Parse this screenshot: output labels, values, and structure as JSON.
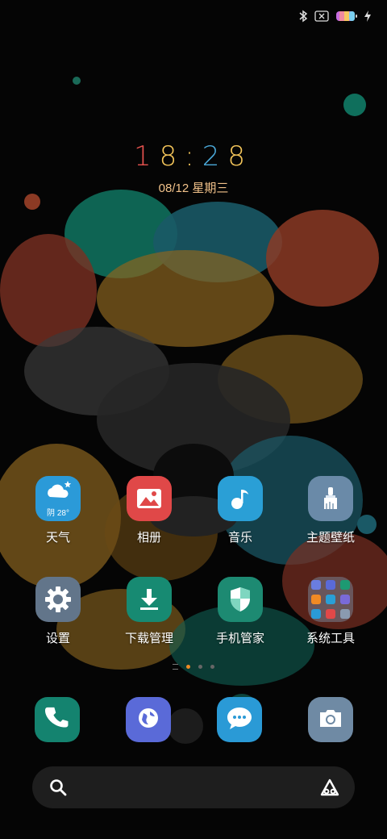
{
  "clock": {
    "d1": "1",
    "d2": "8",
    "sep": ":",
    "d3": "2",
    "d4": "8"
  },
  "date": "08/12 星期三",
  "weather_badge": "阴 28°",
  "apps": [
    {
      "label": "天气",
      "icon": "weather-icon"
    },
    {
      "label": "相册",
      "icon": "gallery-icon"
    },
    {
      "label": "音乐",
      "icon": "music-icon"
    },
    {
      "label": "主题壁纸",
      "icon": "theme-brush-icon"
    },
    {
      "label": "设置",
      "icon": "gear-icon"
    },
    {
      "label": "下载管理",
      "icon": "download-icon"
    },
    {
      "label": "手机管家",
      "icon": "shield-icon"
    },
    {
      "label": "系统工具",
      "icon": "folder-icon"
    }
  ],
  "dock": [
    {
      "icon": "phone-icon"
    },
    {
      "icon": "browser-icon"
    },
    {
      "icon": "messages-icon"
    },
    {
      "icon": "camera-icon"
    }
  ],
  "status_icons": [
    "bluetooth-icon",
    "no-sim-icon",
    "battery-icon",
    "charging-icon"
  ],
  "pager": {
    "pages": 3,
    "active_page": 1
  },
  "colors": {
    "clock_digits": [
      "#e8534f",
      "#f5c65a",
      "#f5c65a",
      "#4aa8d8",
      "#f5c65a"
    ],
    "date": "#f2c28a",
    "weather": "#2b9ad8",
    "gallery": "#e04848",
    "music": "#2a9fd6",
    "theme": "#6a8aa8",
    "settings": "#62758a",
    "download": "#178a72",
    "shield": "#1d8a72",
    "phone": "#14836f",
    "browser": "#5a6ad8",
    "messages": "#2a9ad6",
    "camera": "#6f8aa4",
    "pager_active": "#f08a24"
  }
}
